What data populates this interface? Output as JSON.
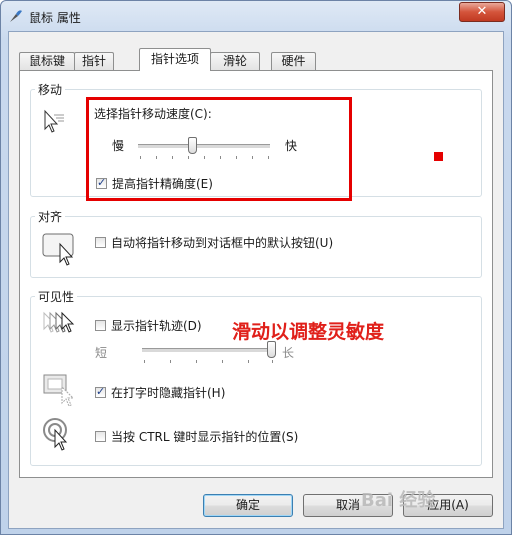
{
  "window": {
    "title": "鼠标 属性",
    "close_symbol": "✕"
  },
  "tabs": [
    {
      "label": "鼠标键"
    },
    {
      "label": "指针"
    },
    {
      "label": "指针选项"
    },
    {
      "label": "滑轮"
    },
    {
      "label": "硬件"
    }
  ],
  "motion": {
    "group_label": "移动",
    "speed_label": "选择指针移动速度(C):",
    "slow_label": "慢",
    "fast_label": "快",
    "speed_value": 0.4,
    "precision_label": "提高指针精确度(E)",
    "precision_checked": true
  },
  "snap": {
    "group_label": "对齐",
    "snap_label": "自动将指针移动到对话框中的默认按钮(U)",
    "snap_checked": false
  },
  "visibility": {
    "group_label": "可见性",
    "trails_label": "显示指针轨迹(D)",
    "trails_checked": false,
    "short_label": "短",
    "long_label": "长",
    "trails_value": 1.0,
    "hide_label": "在打字时隐藏指针(H)",
    "hide_checked": true,
    "ctrl_label": "当按 CTRL 键时显示指针的位置(S)",
    "ctrl_checked": false
  },
  "annotation": {
    "text": "滑动以调整灵敏度",
    "color": "#e0201a"
  },
  "buttons": {
    "ok": "确定",
    "cancel": "取消",
    "apply": "应用(A)"
  },
  "watermark": "Bai 经验"
}
